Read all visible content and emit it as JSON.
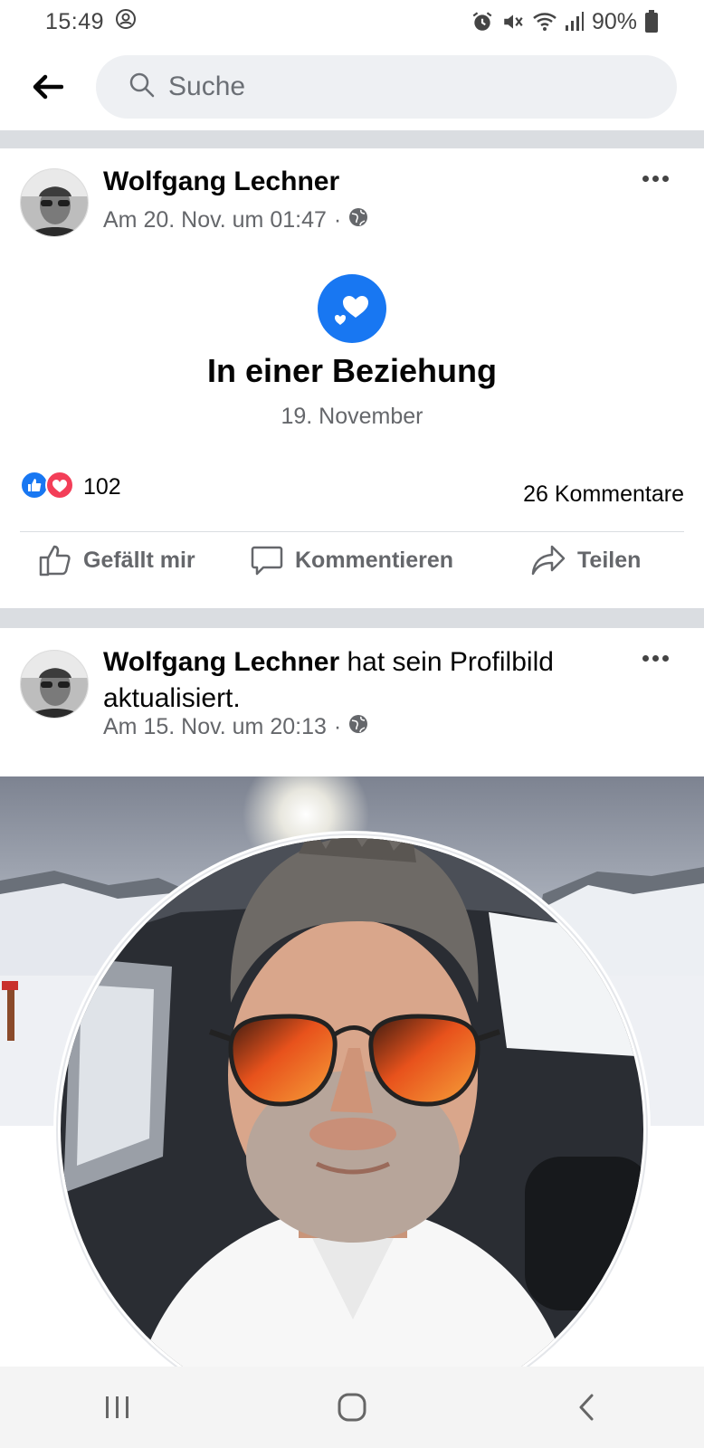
{
  "status_bar": {
    "time": "15:49",
    "battery": "90%",
    "icons": [
      "account-circle-icon",
      "alarm-icon",
      "mute-icon",
      "wifi-icon",
      "signal-icon",
      "battery-icon"
    ]
  },
  "search": {
    "placeholder": "Suche"
  },
  "posts": [
    {
      "author": "Wolfgang Lechner",
      "timestamp": "Am 20. Nov. um 01:47",
      "privacy": "globe-icon",
      "life_event": {
        "title": "In einer Beziehung",
        "date": "19. November"
      },
      "reactions": {
        "count": "102",
        "types": [
          "like",
          "love"
        ]
      },
      "comments": "26 Kommentare",
      "actions": {
        "like": "Gefällt mir",
        "comment": "Kommentieren",
        "share": "Teilen"
      }
    },
    {
      "author": "Wolfgang Lechner",
      "action_text": " hat sein Profilbild aktualisiert.",
      "timestamp": "Am 15. Nov. um 20:13",
      "privacy": "globe-icon"
    }
  ],
  "colors": {
    "facebook_blue": "#1877f2",
    "love_red": "#f33e58",
    "divider": "#dadde1",
    "secondary_text": "#65676b"
  }
}
